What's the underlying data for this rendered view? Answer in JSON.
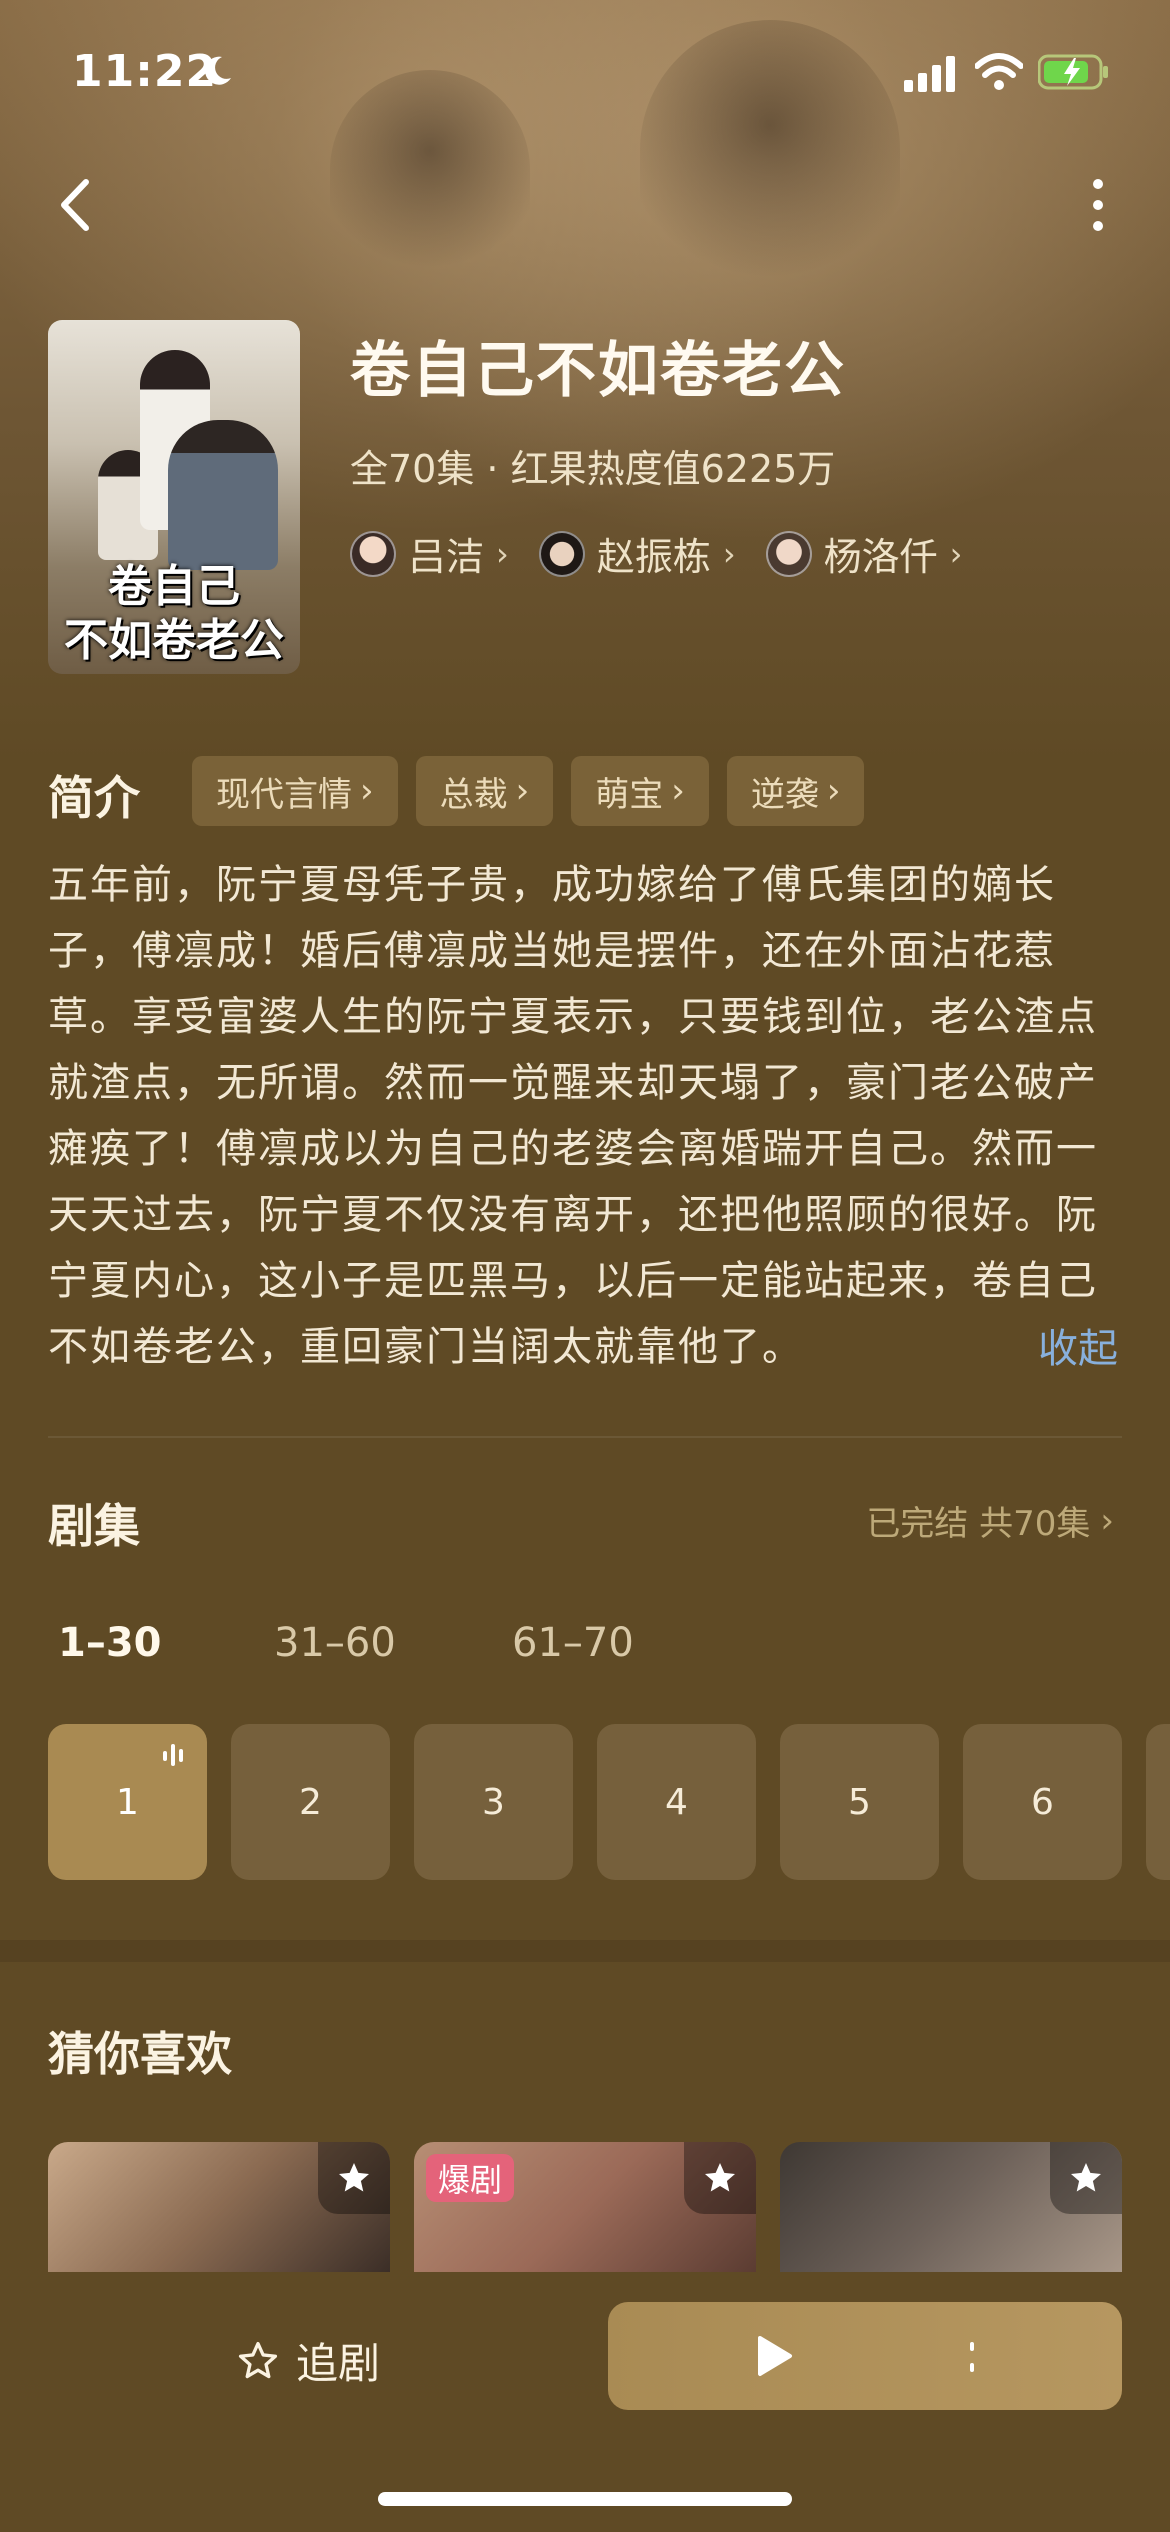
{
  "status_bar": {
    "time": "11:22"
  },
  "drama": {
    "title": "卷自己不如卷老公",
    "poster_title_line1": "卷自己",
    "poster_title_line2": "不如卷老公",
    "meta": "全70集 · 红果热度值6225万",
    "cast": [
      {
        "name": "吕洁"
      },
      {
        "name": "赵振栋"
      },
      {
        "name": "杨洛仟"
      }
    ]
  },
  "intro": {
    "heading": "简介",
    "tags": [
      "现代言情",
      "总裁",
      "萌宝",
      "逆袭"
    ],
    "text": "五年前，阮宁夏母凭子贵，成功嫁给了傅氏集团的嫡长子，傅凛成！婚后傅凛成当她是摆件，还在外面沾花惹草。享受富婆人生的阮宁夏表示，只要钱到位，老公渣点就渣点，无所谓。然而一觉醒来却天塌了，豪门老公破产瘫痪了！傅凛成以为自己的老婆会离婚踹开自己。然而一天天过去，阮宁夏不仅没有离开，还把他照顾的很好。阮宁夏内心，这小子是匹黑马，以后一定能站起来，卷自己不如卷老公，重回豪门当阔太就靠他了。",
    "collapse_label": "收起"
  },
  "episodes": {
    "heading": "剧集",
    "status": "已完结 共70集",
    "ranges": [
      "1–30",
      "31–60",
      "61–70"
    ],
    "active_range": 0,
    "items": [
      "1",
      "2",
      "3",
      "4",
      "5",
      "6"
    ],
    "current": "1"
  },
  "recommend": {
    "heading": "猜你喜欢",
    "hot_badge": "爆剧"
  },
  "bottom": {
    "follow_label": "追剧"
  },
  "colors": {
    "background": "#5f4a25",
    "accent": "#a98a52",
    "tag_bg": "#7a6238",
    "link": "#88b0dc"
  }
}
